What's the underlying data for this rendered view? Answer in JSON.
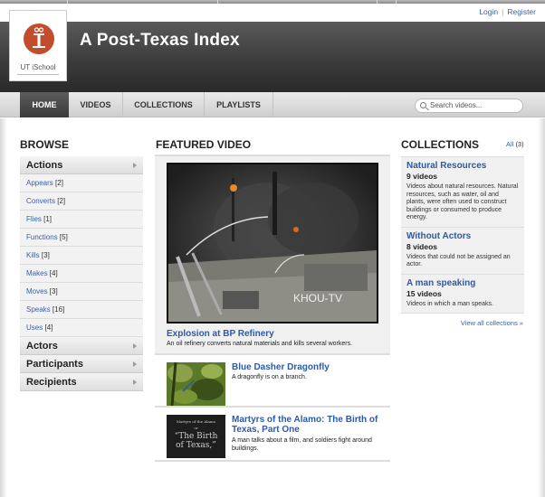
{
  "user_links": {
    "login": "Login",
    "separator": "|",
    "register": "Register"
  },
  "logo": {
    "text": "UT iSchool"
  },
  "site": {
    "title": "A Post-Texas Index"
  },
  "nav": {
    "items": [
      {
        "label": "HOME",
        "active": true
      },
      {
        "label": "VIDEOS",
        "active": false
      },
      {
        "label": "COLLECTIONS",
        "active": false
      },
      {
        "label": "PLAYLISTS",
        "active": false
      }
    ],
    "search_placeholder": "Search videos..."
  },
  "browse": {
    "heading": "BROWSE",
    "categories": [
      {
        "label": "Actions",
        "expanded": true
      },
      {
        "label": "Actors",
        "expanded": false
      },
      {
        "label": "Participants",
        "expanded": false
      },
      {
        "label": "Recipients",
        "expanded": false
      }
    ],
    "actions": [
      {
        "label": "Appears",
        "count": "[2]"
      },
      {
        "label": "Converts",
        "count": "[2]"
      },
      {
        "label": "Flies",
        "count": "[1]"
      },
      {
        "label": "Functions",
        "count": "[5]"
      },
      {
        "label": "Kills",
        "count": "[3]"
      },
      {
        "label": "Makes",
        "count": "[4]"
      },
      {
        "label": "Moves",
        "count": "[3]"
      },
      {
        "label": "Speaks",
        "count": "[16]"
      },
      {
        "label": "Uses",
        "count": "[4]"
      }
    ]
  },
  "featured": {
    "heading": "FEATURED VIDEO",
    "main": {
      "title": "Explosion at BP Refinery",
      "description": "An oil refinery converts natural materials and kills several workers.",
      "watermark": "KHOU-TV"
    },
    "videos": [
      {
        "title": "Blue Dasher Dragonfly",
        "description": "A dragonfly is on a branch."
      },
      {
        "title": "Martyrs of the Alamo: The Birth of Texas, Part One",
        "description": "A man talks about a film, and soldiers fight around buildings.",
        "thumb_caption_small": "Martyrs of the Alamo",
        "thumb_caption_or": "or",
        "thumb_caption_line1": "“The Birth",
        "thumb_caption_line2": "of Texas,”"
      }
    ]
  },
  "collections": {
    "heading": "COLLECTIONS",
    "all_label": "All",
    "all_count": "(3)",
    "items": [
      {
        "title": "Natural Resources",
        "count": "9 videos",
        "description": "Videos about natural resources. Natural resources, such as water, oil and plants, were often used to construct buildings or consumed to produce energy."
      },
      {
        "title": "Without Actors",
        "count": "8 videos",
        "description": "Videos that could not be assigned an actor."
      },
      {
        "title": "A man speaking",
        "count": "15 videos",
        "description": "Videos in which a man speaks."
      }
    ],
    "view_all": "View all collections »"
  },
  "colors": {
    "accent_link": "#3a5fa6",
    "title_blue": "#2c5aa8",
    "logo_orange": "#c24d2c",
    "masthead_dark": "#3c3c3c"
  }
}
